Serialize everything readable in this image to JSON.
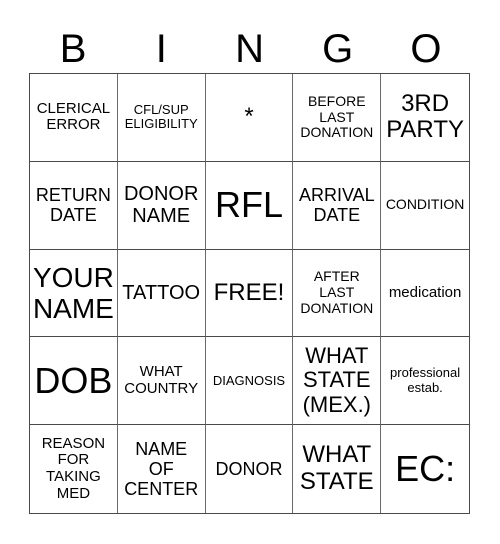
{
  "header": {
    "letters": [
      "B",
      "I",
      "N",
      "G",
      "O"
    ]
  },
  "card": {
    "rows": [
      [
        "CLERICAL\nERROR",
        "CFL/SUP\nELIGIBILITY",
        "*",
        "BEFORE\nLAST\nDONATION",
        "3RD\nPARTY"
      ],
      [
        "RETURN\nDATE",
        "DONOR\nNAME",
        "RFL",
        "ARRIVAL\nDATE",
        "CONDITION"
      ],
      [
        "YOUR\nNAME",
        "TATTOO",
        "FREE!",
        "AFTER\nLAST\nDONATION",
        "medication"
      ],
      [
        "DOB",
        "WHAT\nCOUNTRY",
        "DIAGNOSIS",
        "WHAT\nSTATE\n(MEX.)",
        "professional\nestab."
      ],
      [
        "REASON\nFOR\nTAKING\nMED",
        "NAME\nOF\nCENTER",
        "DONOR",
        "WHAT\nSTATE",
        "EC:"
      ]
    ],
    "free_space": "FREE!"
  }
}
